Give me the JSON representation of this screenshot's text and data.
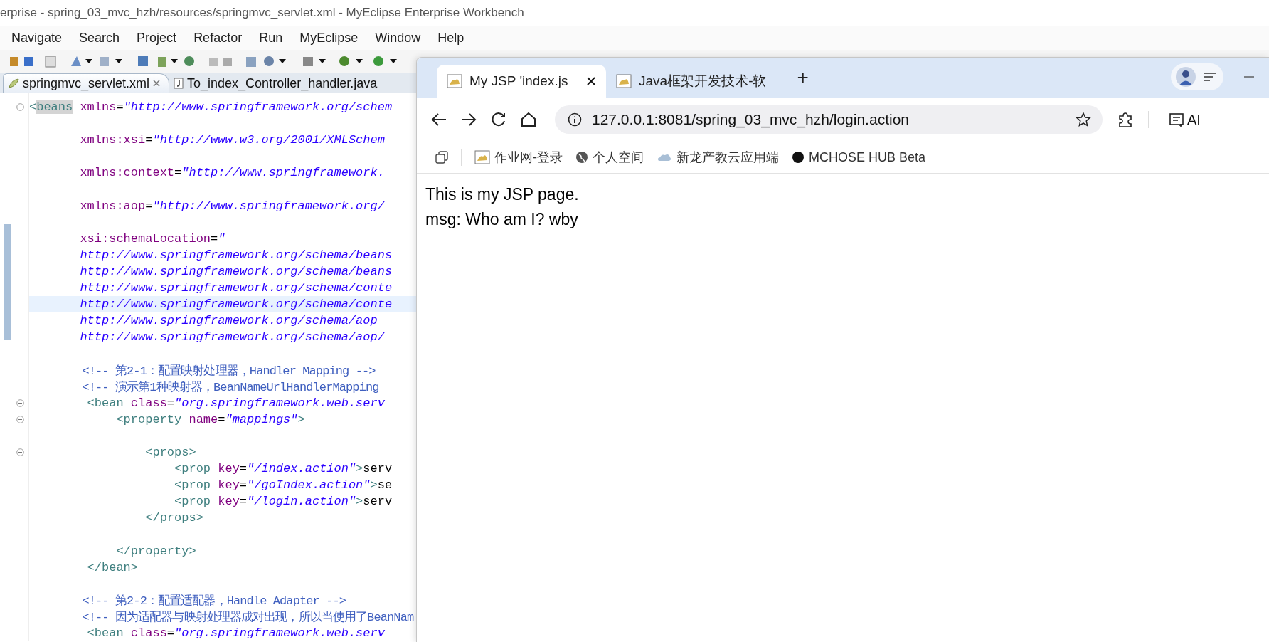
{
  "ide": {
    "title": "erprise - spring_03_mvc_hzh/resources/springmvc_servlet.xml - MyEclipse Enterprise Workbench",
    "menu": [
      "Navigate",
      "Search",
      "Project",
      "Refactor",
      "Run",
      "MyEclipse",
      "Window",
      "Help"
    ],
    "editor_tabs": [
      {
        "label": "springmvc_servlet.xml",
        "kind": "xml",
        "selected": true,
        "closable": true
      },
      {
        "label": "To_index_Controller_handler.java",
        "kind": "java",
        "selected": false,
        "closable": false
      }
    ],
    "code_lines": [
      {
        "kind": "code",
        "fold": true,
        "current": false,
        "t": [
          {
            "kind": "tag",
            "text": "<"
          },
          {
            "kind": "tag-hl",
            "text": "beans"
          },
          {
            "kind": "attr",
            "text": " xmlns"
          },
          {
            "kind": "text",
            "text": "="
          },
          {
            "kind": "str",
            "text": "\"http://www.springframework.org/schem"
          }
        ]
      },
      {
        "kind": "blank"
      },
      {
        "kind": "code",
        "fold": false,
        "current": false,
        "t": [
          {
            "kind": "attr",
            "text": "       xmlns:xsi"
          },
          {
            "kind": "text",
            "text": "="
          },
          {
            "kind": "str",
            "text": "\"http://www.w3.org/2001/XMLSchem"
          }
        ]
      },
      {
        "kind": "blank"
      },
      {
        "kind": "code",
        "fold": false,
        "current": false,
        "t": [
          {
            "kind": "attr",
            "text": "       xmlns:context"
          },
          {
            "kind": "text",
            "text": "="
          },
          {
            "kind": "str",
            "text": "\"http://www.springframework."
          }
        ]
      },
      {
        "kind": "blank"
      },
      {
        "kind": "code",
        "fold": false,
        "current": false,
        "t": [
          {
            "kind": "attr",
            "text": "       xmlns:aop"
          },
          {
            "kind": "text",
            "text": "="
          },
          {
            "kind": "str",
            "text": "\"http://www.springframework.org/"
          }
        ]
      },
      {
        "kind": "blank"
      },
      {
        "kind": "code",
        "fold": false,
        "current": false,
        "t": [
          {
            "kind": "attr",
            "text": "       xsi:schemaLocation"
          },
          {
            "kind": "text",
            "text": "="
          },
          {
            "kind": "str",
            "text": "\""
          }
        ]
      },
      {
        "kind": "code",
        "fold": false,
        "current": false,
        "t": [
          {
            "kind": "str",
            "text": "       http://www.springframework.org/schema/beans"
          }
        ]
      },
      {
        "kind": "code",
        "fold": false,
        "current": false,
        "t": [
          {
            "kind": "str",
            "text": "       http://www.springframework.org/schema/beans"
          }
        ]
      },
      {
        "kind": "code",
        "fold": false,
        "current": false,
        "t": [
          {
            "kind": "str",
            "text": "       http://www.springframework.org/schema/conte"
          }
        ]
      },
      {
        "kind": "code",
        "fold": false,
        "current": true,
        "t": [
          {
            "kind": "str",
            "text": "       http://www.springframework.org/schema/conte"
          }
        ]
      },
      {
        "kind": "code",
        "fold": false,
        "current": false,
        "t": [
          {
            "kind": "str",
            "text": "       http://www.springframework.org/schema/aop"
          }
        ]
      },
      {
        "kind": "code",
        "fold": false,
        "current": false,
        "t": [
          {
            "kind": "str",
            "text": "       http://www.springframework.org/schema/aop/"
          }
        ]
      },
      {
        "kind": "blank"
      },
      {
        "kind": "code",
        "fold": false,
        "current": false,
        "t": [
          {
            "kind": "cmt",
            "text": "        <!-- 第2-1：配置映射处理器，Handler Mapping -->"
          }
        ]
      },
      {
        "kind": "code",
        "fold": false,
        "current": false,
        "t": [
          {
            "kind": "cmt",
            "text": "        <!-- 演示第1种映射器，BeanNameUrlHandlerMapping"
          }
        ]
      },
      {
        "kind": "code",
        "fold": true,
        "current": false,
        "t": [
          {
            "kind": "tag",
            "text": "        <bean"
          },
          {
            "kind": "attr",
            "text": " class"
          },
          {
            "kind": "text",
            "text": "="
          },
          {
            "kind": "str",
            "text": "\"org.springframework.web.serv"
          }
        ]
      },
      {
        "kind": "code",
        "fold": true,
        "current": false,
        "t": [
          {
            "kind": "tag",
            "text": "            <property"
          },
          {
            "kind": "attr",
            "text": " name"
          },
          {
            "kind": "text",
            "text": "="
          },
          {
            "kind": "str",
            "text": "\"mappings\""
          },
          {
            "kind": "tag",
            "text": ">"
          }
        ]
      },
      {
        "kind": "blank"
      },
      {
        "kind": "code",
        "fold": true,
        "current": false,
        "t": [
          {
            "kind": "tag",
            "text": "                <props>"
          }
        ]
      },
      {
        "kind": "code",
        "fold": false,
        "current": false,
        "t": [
          {
            "kind": "tag",
            "text": "                    <prop"
          },
          {
            "kind": "attr",
            "text": " key"
          },
          {
            "kind": "text",
            "text": "="
          },
          {
            "kind": "str",
            "text": "\"/index.action\""
          },
          {
            "kind": "tag",
            "text": ">"
          },
          {
            "kind": "text",
            "text": "serv"
          }
        ]
      },
      {
        "kind": "code",
        "fold": false,
        "current": false,
        "t": [
          {
            "kind": "tag",
            "text": "                    <prop"
          },
          {
            "kind": "attr",
            "text": " key"
          },
          {
            "kind": "text",
            "text": "="
          },
          {
            "kind": "str",
            "text": "\"/goIndex.action\""
          },
          {
            "kind": "tag",
            "text": ">"
          },
          {
            "kind": "text",
            "text": "se"
          }
        ]
      },
      {
        "kind": "code",
        "fold": false,
        "current": false,
        "t": [
          {
            "kind": "tag",
            "text": "                    <prop"
          },
          {
            "kind": "attr",
            "text": " key"
          },
          {
            "kind": "text",
            "text": "="
          },
          {
            "kind": "str",
            "text": "\"/login.action\""
          },
          {
            "kind": "tag",
            "text": ">"
          },
          {
            "kind": "text",
            "text": "serv"
          }
        ]
      },
      {
        "kind": "code",
        "fold": false,
        "current": false,
        "t": [
          {
            "kind": "tag",
            "text": "                </props>"
          }
        ]
      },
      {
        "kind": "blank"
      },
      {
        "kind": "code",
        "fold": false,
        "current": false,
        "t": [
          {
            "kind": "tag",
            "text": "            </property>"
          }
        ]
      },
      {
        "kind": "code",
        "fold": false,
        "current": false,
        "t": [
          {
            "kind": "tag",
            "text": "        </bean>"
          }
        ]
      },
      {
        "kind": "blank"
      },
      {
        "kind": "code",
        "fold": false,
        "current": false,
        "t": [
          {
            "kind": "cmt",
            "text": "        <!-- 第2-2：配置适配器，Handle Adapter -->"
          }
        ]
      },
      {
        "kind": "code",
        "fold": false,
        "current": false,
        "t": [
          {
            "kind": "cmt",
            "text": "        <!-- 因为适配器与映射处理器成对出现，所以当使用了BeanNam"
          }
        ]
      },
      {
        "kind": "code",
        "fold": false,
        "current": false,
        "t": [
          {
            "kind": "tag",
            "text": "        <bean"
          },
          {
            "kind": "attr",
            "text": " class"
          },
          {
            "kind": "text",
            "text": "="
          },
          {
            "kind": "str",
            "text": "\"org.springframework.web.serv"
          }
        ]
      }
    ]
  },
  "browser": {
    "tabs": [
      {
        "label": "My JSP 'index.js",
        "selected": true,
        "closable": true
      },
      {
        "label": "Java框架开发技术-软",
        "selected": false,
        "closable": false
      }
    ],
    "new_tab": "+",
    "address": "127.0.0.1:8081/spring_03_mvc_hzh/login.action",
    "ai_button": "AI",
    "bookmarks": [
      {
        "label": "作业网-登录",
        "kind": "site"
      },
      {
        "label": "个人空间",
        "kind": "globe"
      },
      {
        "label": "新龙产教云应用端",
        "kind": "cloud"
      },
      {
        "label": "MCHOSE HUB Beta",
        "kind": "dot"
      }
    ],
    "content": [
      "This is my JSP page.",
      "msg: Who am I? wby"
    ]
  }
}
